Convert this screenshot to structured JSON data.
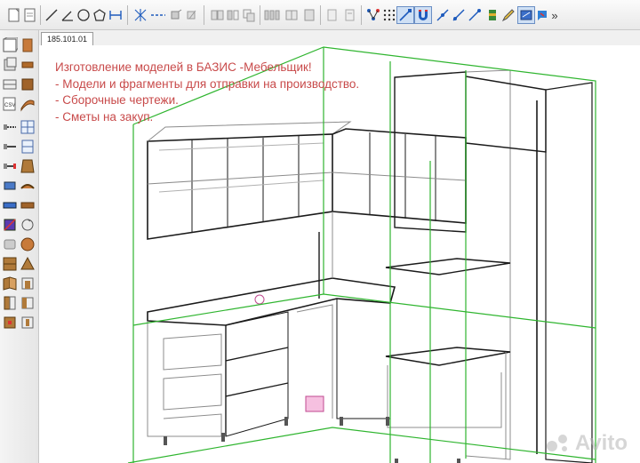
{
  "toolbar": {
    "groups": [
      "drawing-tools",
      "edit-tools",
      "view-tools",
      "model-tools",
      "snap-tools"
    ],
    "overflow_label": "»"
  },
  "document": {
    "tab_label": "185.101.01"
  },
  "overlay": {
    "lines": [
      "Изготовление моделей в БАЗИС -Мебельщик!",
      "- Модели и фрагменты для отправки на производство.",
      "- Сборочные чертежи.",
      "- Сметы на закуп."
    ],
    "color": "#c84a4a"
  },
  "watermark": {
    "text": "Avito"
  },
  "colors": {
    "selection_green": "#2fb52f",
    "wireframe_black": "#1a1a1a",
    "wireframe_grey": "#8c8c8c",
    "accent_blue": "#1e5bbd"
  }
}
